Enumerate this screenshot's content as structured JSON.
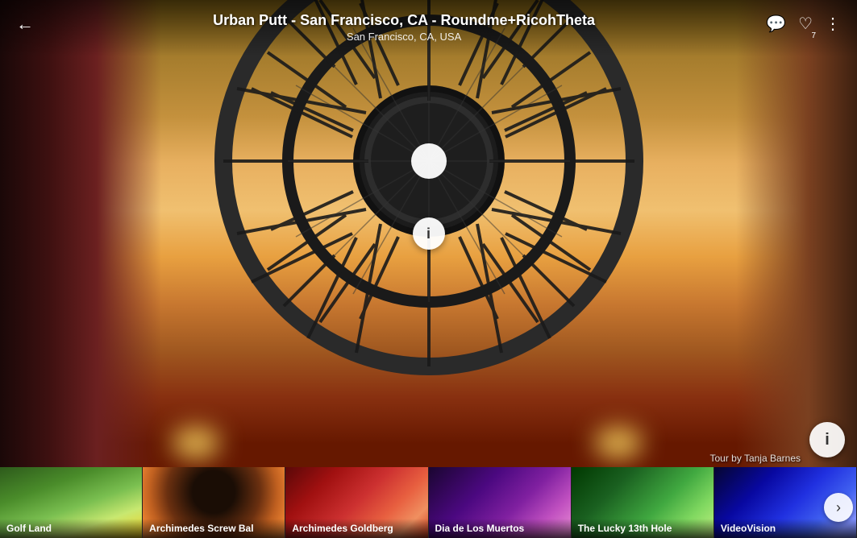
{
  "header": {
    "main_title": "Urban Putt - San Francisco, CA  -  Roundme+RicohTheta",
    "subtitle": "San Francisco, CA, USA",
    "back_label": "←",
    "heart_count": "7",
    "icons": {
      "comment": "💬",
      "heart": "♡",
      "more": "⋮"
    }
  },
  "panorama": {
    "info_button_label": "i",
    "info_bottom_button_label": "i"
  },
  "tour_attribution": "Tour by Tanja Barnes",
  "thumbnails": [
    {
      "id": "golf-land",
      "label": "Golf Land",
      "bg_class": "thumb-golf"
    },
    {
      "id": "archimedes-screw",
      "label": "Archimedes Screw Bal",
      "bg_class": "thumb-archimedes-screw"
    },
    {
      "id": "archimedes-goldberg",
      "label": "Archimedes Goldberg",
      "bg_class": "thumb-archimedes-gold"
    },
    {
      "id": "dia-de-los-muertos",
      "label": "Dia de Los Muertos",
      "bg_class": "thumb-dia"
    },
    {
      "id": "lucky-13th-hole",
      "label": "The Lucky 13th Hole",
      "bg_class": "thumb-lucky"
    },
    {
      "id": "videovision",
      "label": "VideoVision",
      "bg_class": "thumb-video"
    }
  ],
  "next_arrow_label": "›"
}
